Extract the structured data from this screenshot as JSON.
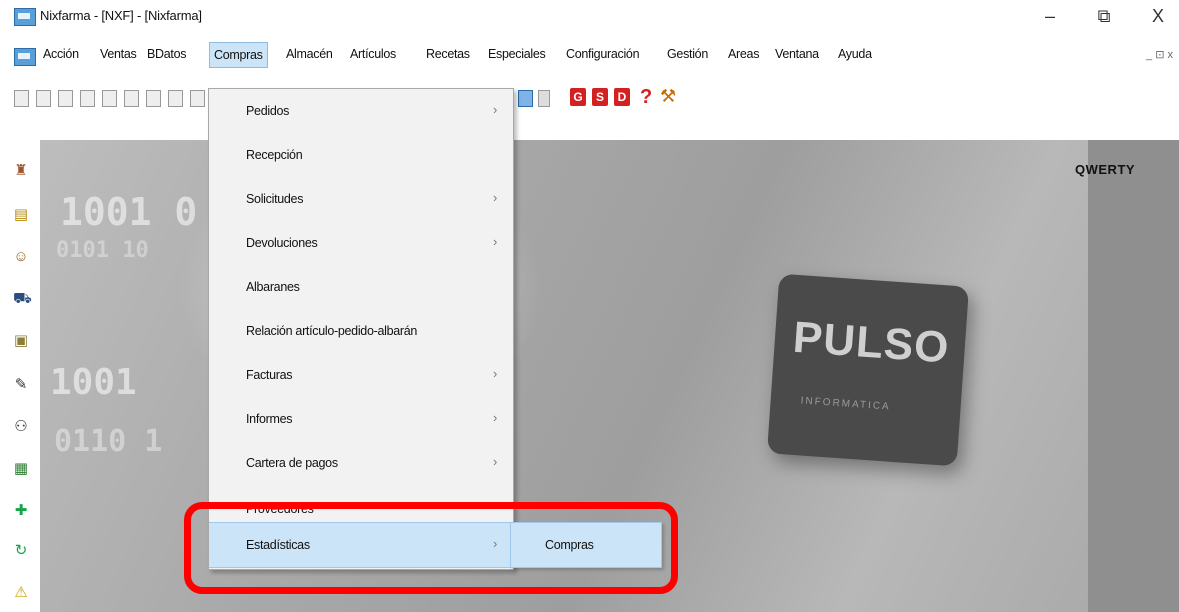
{
  "window": {
    "title": "Nixfarma - [NXF] - [Nixfarma]",
    "minimize": "–",
    "maximize": "⧉",
    "close": "X"
  },
  "menubar": {
    "items": [
      "Acción",
      "Ventas",
      "BDatos",
      "Compras",
      "Almacén",
      "Artículos",
      "Recetas",
      "Especiales",
      "Configuración",
      "Gestión",
      "Areas",
      "Ventana",
      "Ayuda"
    ],
    "active": "Compras",
    "right_controls": "_ ⊡ x"
  },
  "toolbar": {
    "g_label": "G",
    "s_label": "S",
    "d_label": "D",
    "help_label": "?"
  },
  "workspace": {
    "logo_text": "PULSO",
    "logo_subtext": "INFORMATICA",
    "user_label": "QWERTY"
  },
  "dropdown": {
    "items": [
      {
        "label": "Pedidos",
        "arrow": "›"
      },
      {
        "label": "Recepción",
        "arrow": ""
      },
      {
        "label": "Solicitudes",
        "arrow": "›"
      },
      {
        "label": "Devoluciones",
        "arrow": "›"
      },
      {
        "label": "Albaranes",
        "arrow": ""
      },
      {
        "label": "Relación artículo-pedido-albarán",
        "arrow": ""
      },
      {
        "label": "Facturas",
        "arrow": "›"
      },
      {
        "label": "Informes",
        "arrow": "›"
      },
      {
        "label": "Cartera de pagos",
        "arrow": "›"
      },
      {
        "label": "Proveedores",
        "arrow": "›"
      },
      {
        "label": "Estadísticas",
        "arrow": "›"
      }
    ],
    "highlighted": "Estadísticas"
  },
  "submenu": {
    "items": [
      {
        "label": "Compras"
      }
    ]
  },
  "colors": {
    "highlight": "#cce4f7",
    "annotation": "#ff0000"
  }
}
